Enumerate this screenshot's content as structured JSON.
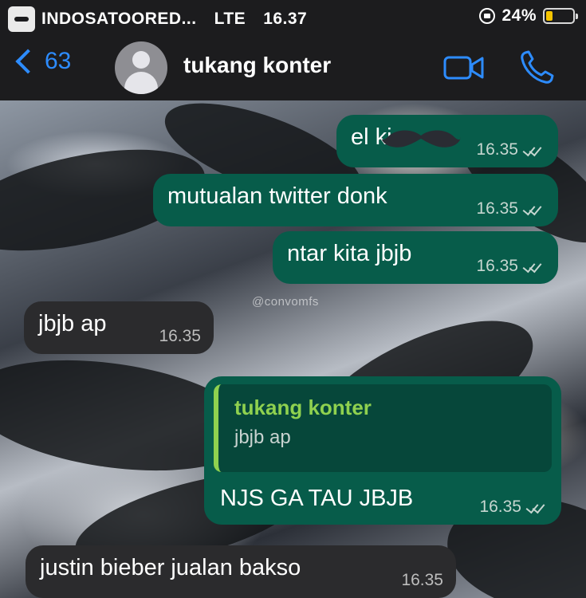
{
  "status_bar": {
    "carrier": "INDOSATOORED...",
    "network": "LTE",
    "time": "16.37",
    "battery": "24%",
    "battery_level": 0.24,
    "icons": [
      "carrier-icon",
      "orientation-lock-icon",
      "battery-icon"
    ]
  },
  "header": {
    "back_count": "63",
    "contact_name": "tukang konter",
    "icons": [
      "chevron-left-icon",
      "avatar-icon",
      "video-call-icon",
      "phone-icon"
    ],
    "accent_color": "#2d8cff"
  },
  "chat": {
    "watermark": "@convomfs",
    "messages": [
      {
        "direction": "out",
        "text": "el  ki",
        "time": "16.35",
        "status": "read"
      },
      {
        "direction": "out",
        "text": "mutualan twitter donk",
        "time": "16.35",
        "status": "read"
      },
      {
        "direction": "out",
        "text": "ntar kita jbjb",
        "time": "16.35",
        "status": "read"
      },
      {
        "direction": "in",
        "text": "jbjb ap",
        "time": "16.35"
      },
      {
        "direction": "out",
        "reply_to": {
          "author": "tukang konter",
          "text": "jbjb ap"
        },
        "text": "NJS GA TAU JBJB",
        "time": "16.35",
        "status": "read"
      },
      {
        "direction": "in",
        "text": "justin bieber jualan bakso",
        "time": "16.35"
      }
    ],
    "colors": {
      "outgoing": "#075c4a",
      "incoming": "#2b2b2d",
      "quote_author": "#8fd14f"
    }
  }
}
